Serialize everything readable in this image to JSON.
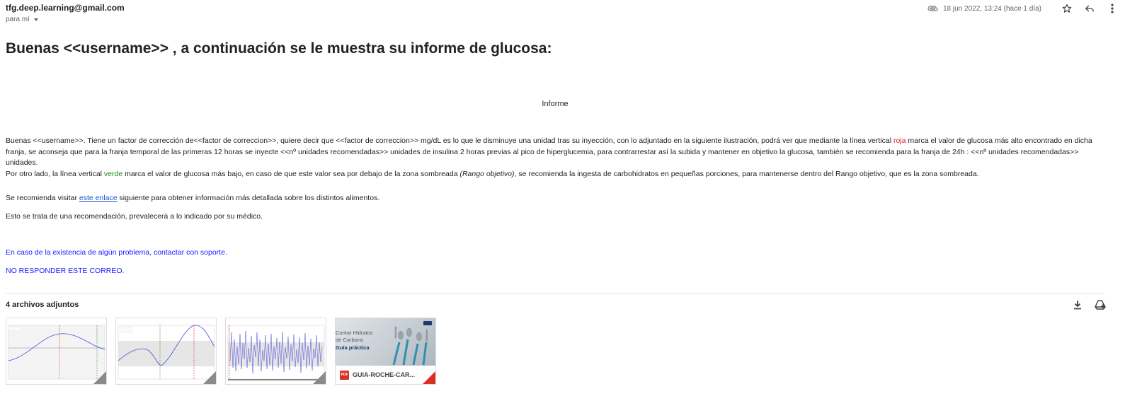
{
  "header": {
    "sender": "tfg.deep.learning@gmail.com",
    "recipient": "para mí",
    "date": "18 jun 2022, 13:24 (hace 1 día)"
  },
  "email": {
    "heading": "Buenas <<username>> , a continuación se le muestra su informe de glucosa:",
    "report_title": "Informe",
    "para1_a": "Buenas <<username>>. Tiene un factor de corrección de<<factor de correccion>>, quiere decir que <<factor de correccion>> mg/dL es lo que le disminuye una unidad tras su inyección, con lo adjuntado en la siguiente ilustración, podrá ver que mediante la línea vertical ",
    "para1_red": "roja",
    "para1_b": " marca el valor de glucosa más alto encontrado en dicha franja, se aconseja que para la franja temporal de las primeras 12 horas se inyecte <<nº unidades recomendadas>> unidades de insulina 2 horas previas al pico de hiperglucemia, para contrarrestar así la subida y mantener en objetivo la glucosa, también se recomienda para la franja de 24h : <<nº unidades recomendadas>> unidades.",
    "para2_a": "Por otro lado, la línea vertical ",
    "para2_green": "verde",
    "para2_b": " marca el valor de glucosa más bajo, en caso de que este valor sea por debajo de la zona sombreada ",
    "para2_italic": "(Rango objetivo)",
    "para2_c": ", se recomienda la ingesta de carbohidratos en pequeñas porciones, para mantenerse dentro del Rango objetivo, que es la zona sombreada.",
    "visit_a": "Se recomienda visitar ",
    "visit_link": "este enlace",
    "visit_b": " siguiente para obtener información más detallada sobre los distintos alimentos.",
    "disclaimer": "Esto se trata de una recomendación, prevalecerá a lo indicado por su médico.",
    "support": "En caso de la existencia de algún problema, contactar con soporte.",
    "noreply": "NO RESPONDER ESTE CORREO."
  },
  "attachments": {
    "title": "4 archivos adjuntos",
    "pdf_line1": "Contar Hidratos",
    "pdf_line2": "de Carbono",
    "pdf_line3": "Guía práctica",
    "pdf_badge": "PDF",
    "pdf_name": "GUIA-ROCHE-CAR..."
  },
  "colors": {
    "red_line": "#e51c1c",
    "green_line": "#1e8a1e",
    "link": "#1155cc",
    "blue_text": "#1a1aff"
  },
  "icons": [
    "attachment-icon",
    "star-icon",
    "reply-icon",
    "more-icon",
    "download-icon",
    "add-to-drive-icon",
    "pdf-icon"
  ]
}
